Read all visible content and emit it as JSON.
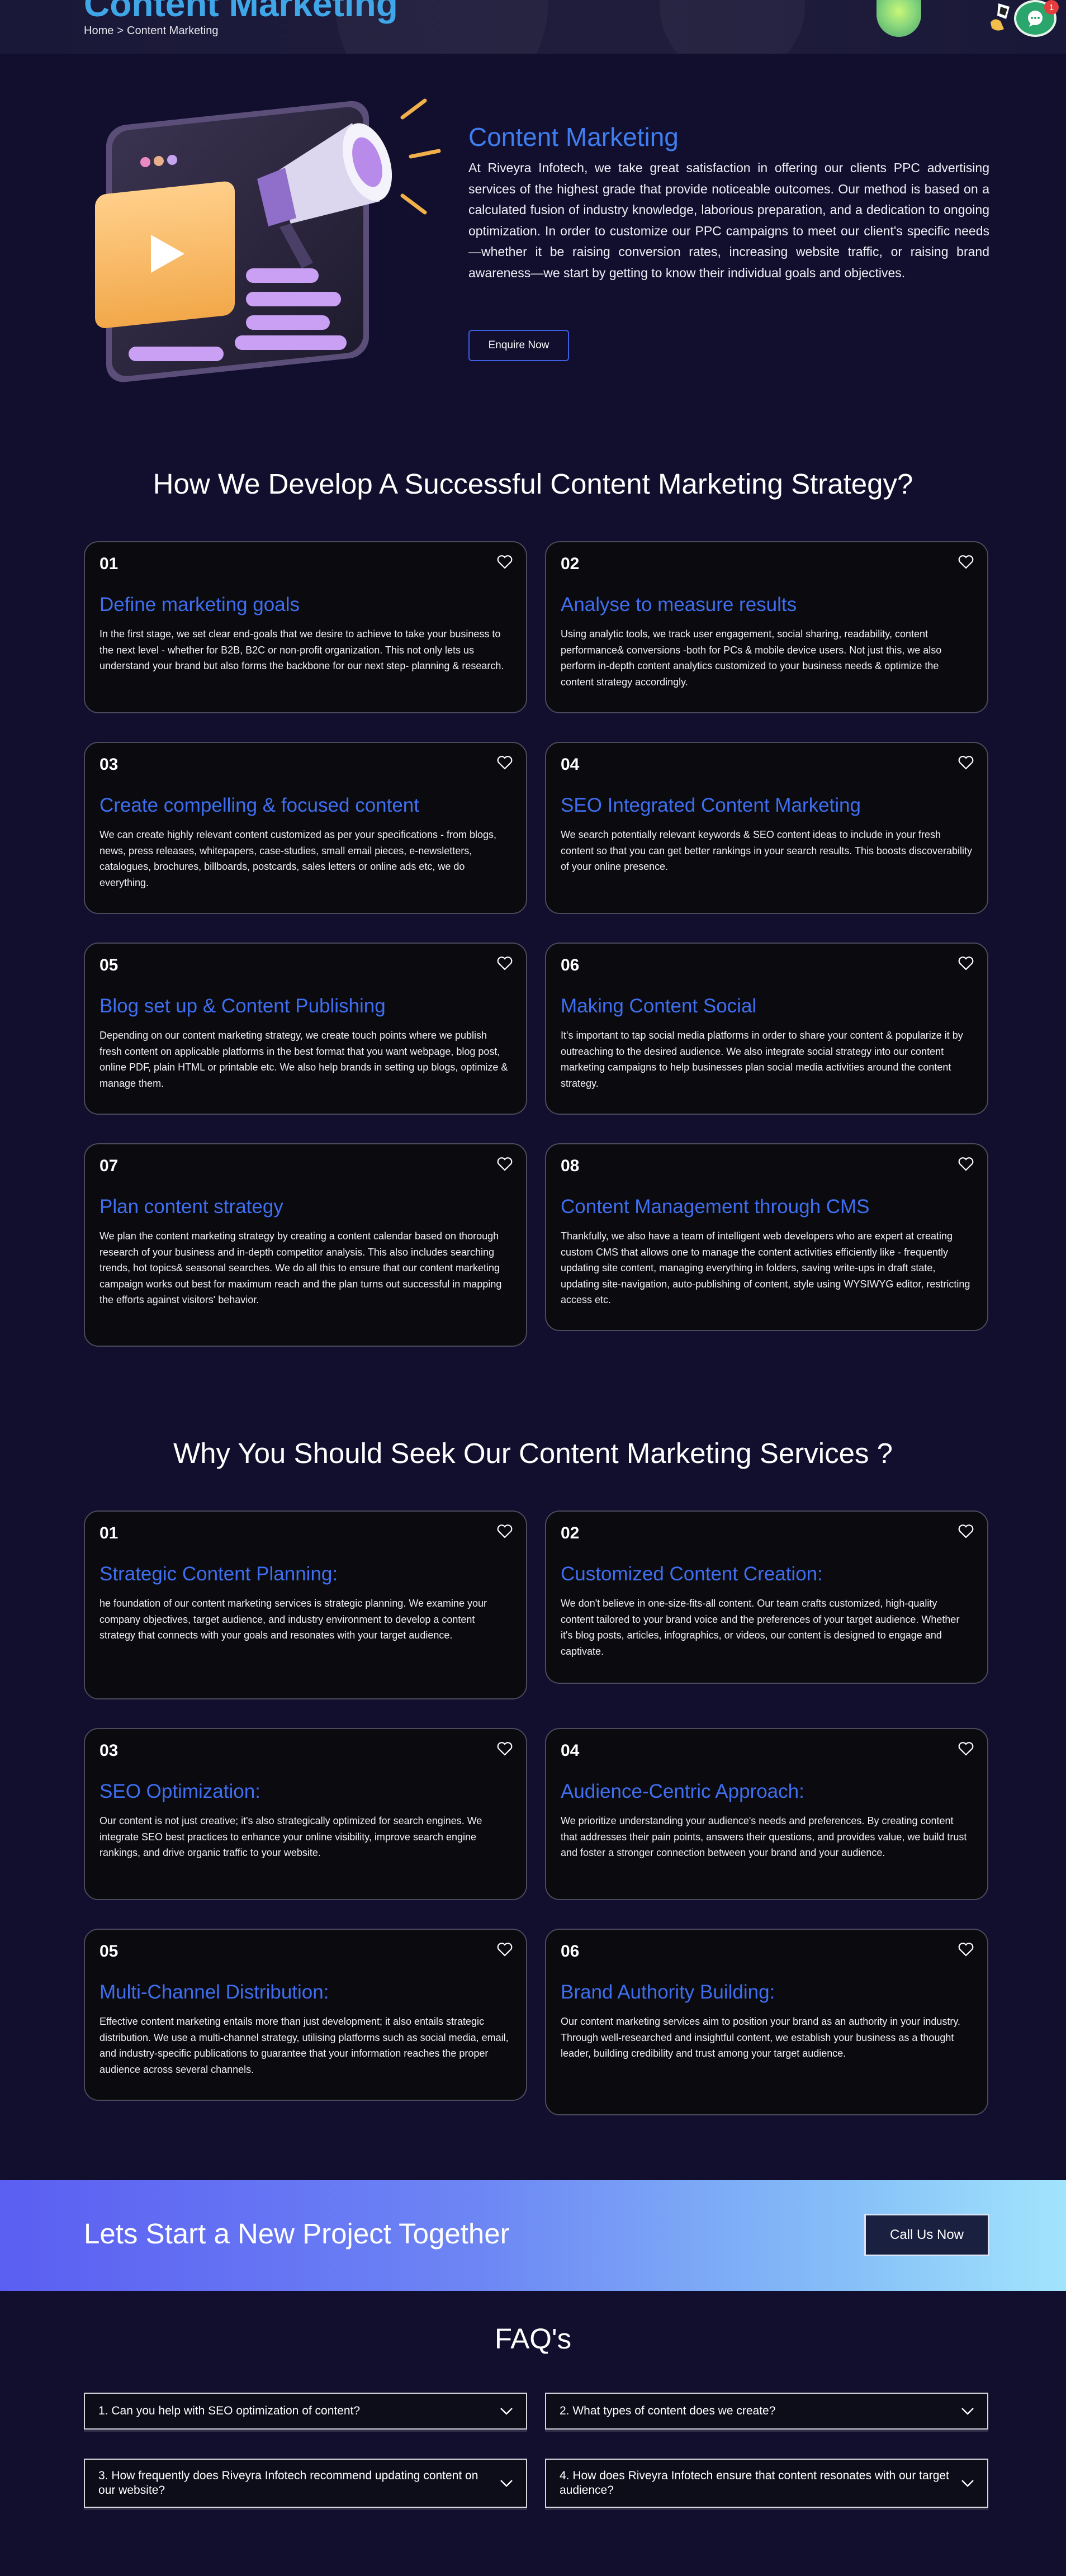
{
  "hero": {
    "title": "Content Marketing",
    "breadcrumb": {
      "home": "Home",
      "separator": ">",
      "current": "Content Marketing"
    },
    "chat_badge": "1"
  },
  "intro": {
    "heading": "Content Marketing",
    "text": "At Riveyra Infotech, we take great satisfaction in offering our clients PPC advertising services of the highest grade that provide noticeable outcomes. Our method is based on a calculated fusion of industry knowledge, laborious preparation, and a dedication to ongoing optimization. In order to customize our PPC campaigns to meet our client's specific needs—whether it be raising conversion rates, increasing website traffic, or raising brand awareness—we start by getting to know their individual goals and objectives.",
    "button": "Enquire Now"
  },
  "strategy": {
    "title": "How We Develop A Successful Content Marketing Strategy?",
    "cards": [
      {
        "num": "01",
        "title": "Define marketing goals",
        "body": "In the first stage, we set clear end-goals that we desire to achieve to take your business to the next level - whether for B2B, B2C or non-profit organization. This not only lets us understand your brand but also forms the backbone for our next step- planning & research."
      },
      {
        "num": "02",
        "title": "Analyse to measure results",
        "body": "Using analytic tools, we track user engagement, social sharing, readability, content performance& conversions -both for PCs & mobile device users. Not just this, we also perform in-depth content analytics customized to your business needs & optimize the content strategy accordingly."
      },
      {
        "num": "03",
        "title": "Create compelling & focused content",
        "body": "We can create highly relevant content customized as per your specifications - from blogs, news, press releases, whitepapers, case-studies, small email pieces, e-newsletters, catalogues, brochures, billboards, postcards, sales letters or online ads etc, we do everything."
      },
      {
        "num": "04",
        "title": "SEO Integrated Content Marketing",
        "body": "We search potentially relevant keywords & SEO content ideas to include in your fresh content so that you can get better rankings in your search results. This boosts discoverability of your online presence."
      },
      {
        "num": "05",
        "title": "Blog set up & Content Publishing",
        "body": "Depending on our content marketing strategy, we create touch points where we publish fresh content on applicable platforms in the best format that you want webpage, blog post, online PDF, plain HTML or printable etc. We also help brands in setting up blogs, optimize & manage them."
      },
      {
        "num": "06",
        "title": "Making Content Social",
        "body": "It's important to tap social media platforms in order to share your content & popularize it by outreaching to the desired audience. We also integrate social strategy into our content marketing campaigns to help businesses plan social media activities around the content strategy."
      },
      {
        "num": "07",
        "title": "Plan content strategy",
        "body": "We plan the content marketing strategy by creating a content calendar based on thorough research of your business and in-depth competitor analysis. This also includes searching trends, hot topics& seasonal searches. We do all this to ensure that our content marketing campaign works out best for maximum reach and the plan turns out successful in mapping the efforts against visitors' behavior."
      },
      {
        "num": "08",
        "title": "Content Management through CMS",
        "body": "Thankfully, we also have a team of intelligent web developers who are expert at creating custom CMS that allows one to manage the content activities efficiently like - frequently updating site content, managing everything in folders, saving write-ups in draft state, updating site-navigation, auto-publishing of content, style using WYSIWYG editor, restricting access etc."
      }
    ]
  },
  "why": {
    "title": "Why You Should Seek Our Content Marketing Services ?",
    "cards": [
      {
        "num": "01",
        "title": "Strategic Content Planning:",
        "body": "he foundation of our content marketing services is strategic planning. We examine your company objectives, target audience, and industry environment to develop a content strategy that connects with your goals and resonates with your target audience."
      },
      {
        "num": "02",
        "title": "Customized Content Creation:",
        "body": "We don't believe in one-size-fits-all content. Our team crafts customized, high-quality content tailored to your brand voice and the preferences of your target audience. Whether it's blog posts, articles, infographics, or videos, our content is designed to engage and captivate."
      },
      {
        "num": "03",
        "title": "SEO Optimization:",
        "body": "Our content is not just creative; it's also strategically optimized for search engines. We integrate SEO best practices to enhance your online visibility, improve search engine rankings, and drive organic traffic to your website."
      },
      {
        "num": "04",
        "title": "Audience-Centric Approach:",
        "body": "We prioritize understanding your audience's needs and preferences. By creating content that addresses their pain points, answers their questions, and provides value, we build trust and foster a stronger connection between your brand and your audience."
      },
      {
        "num": "05",
        "title": "Multi-Channel Distribution:",
        "body": "Effective content marketing entails more than just development; it also entails strategic distribution. We use a multi-channel strategy, utilising platforms such as social media, email, and industry-specific publications to guarantee that your information reaches the proper audience across several channels."
      },
      {
        "num": "06",
        "title": "Brand Authority Building:",
        "body": "Our content marketing services aim to position your brand as an authority in your industry. Through well-researched and insightful content, we establish your business as a thought leader, building credibility and trust among your target audience."
      }
    ]
  },
  "cta": {
    "text": "Lets Start a New Project Together",
    "button": "Call Us Now"
  },
  "faq": {
    "title": "FAQ's",
    "items": [
      "1. Can you help with SEO optimization of content?",
      "2. What types of content does we create?",
      "3. How frequently does Riveyra Infotech recommend updating content on our website?",
      "4. How does Riveyra Infotech ensure that content resonates with our target audience?"
    ]
  },
  "colors": {
    "background": "#120f2e",
    "accent_blue": "#3f6ff0",
    "card_bg": "#0a0a0f",
    "card_border": "#4a4a5c",
    "hero_title": "#3fa7e8"
  },
  "icons": [
    "heart-icon",
    "chevron-down-icon",
    "chat-icon",
    "megaphone-illustration",
    "play-icon"
  ]
}
